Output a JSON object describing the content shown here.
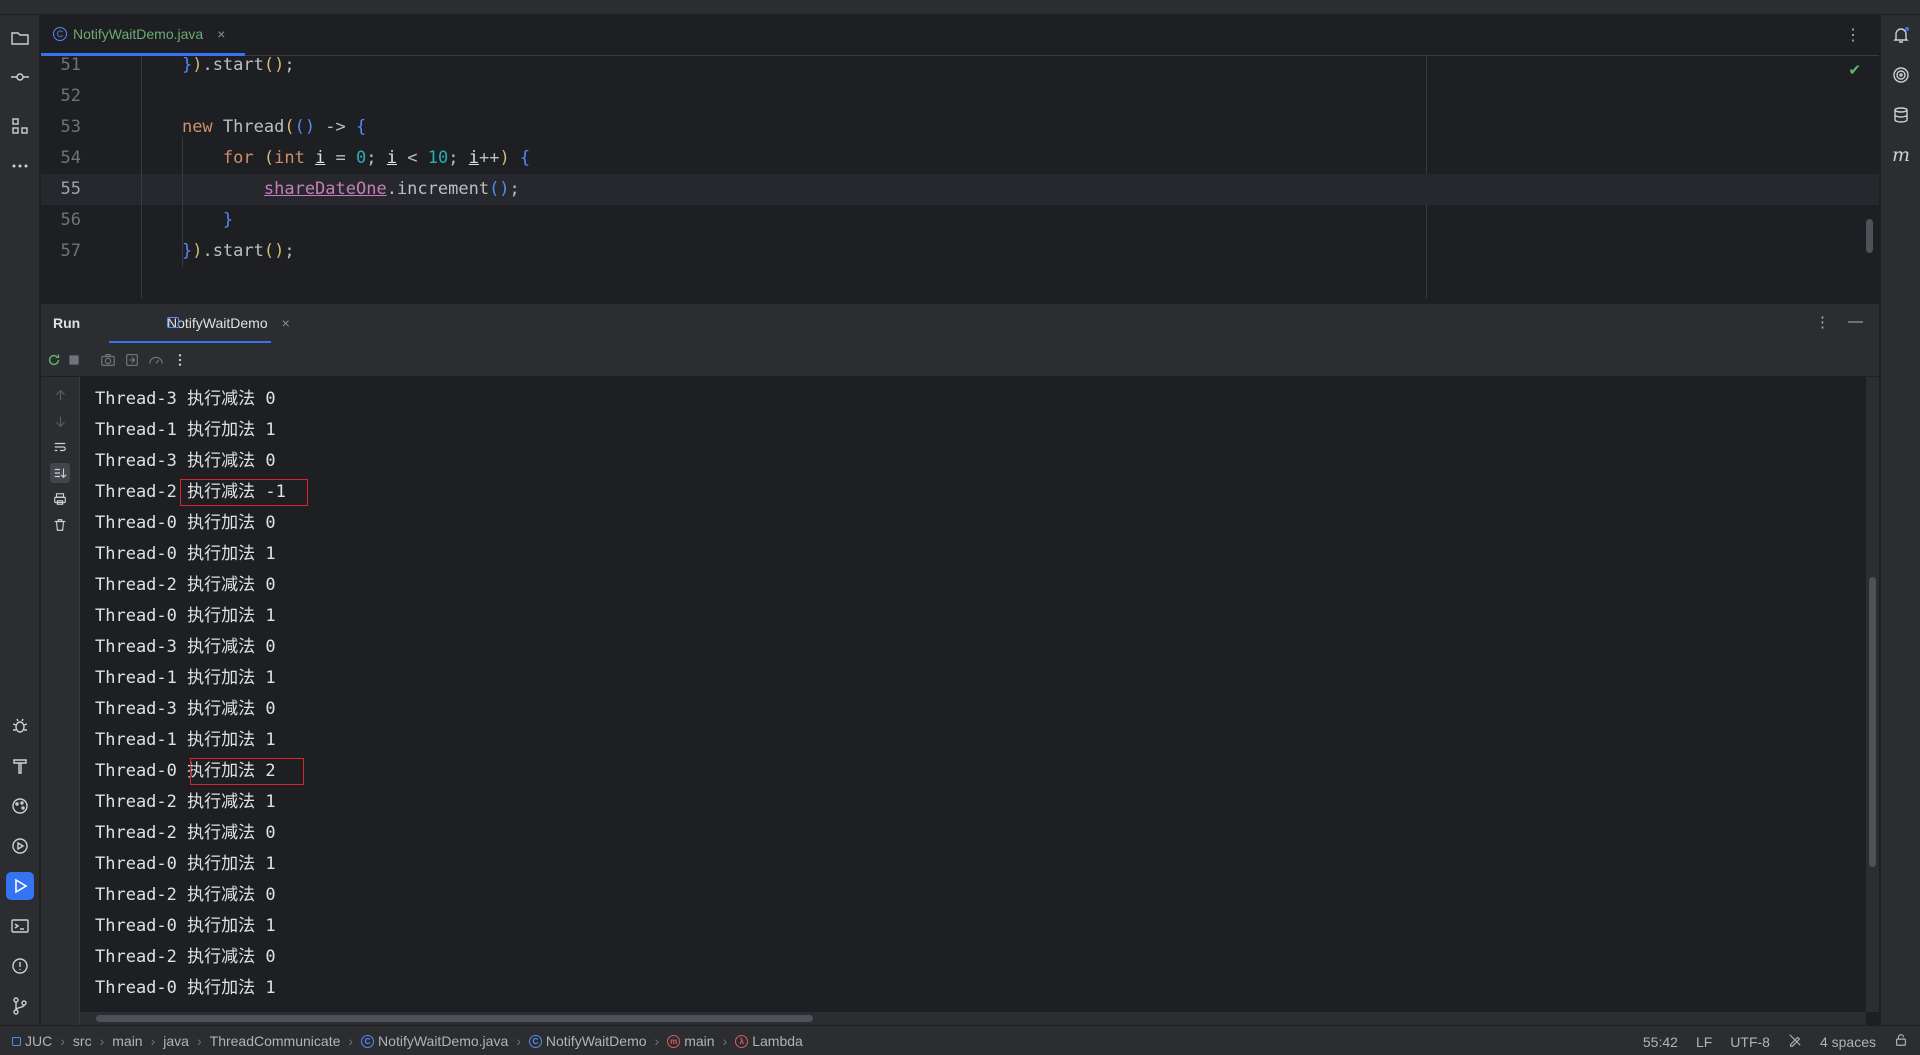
{
  "editor": {
    "tab": {
      "file_name": "NotifyWaitDemo.java",
      "close": "×"
    },
    "more": "⋮",
    "lines": [
      {
        "num": "51",
        "tokens": [
          {
            "t": "}",
            "c": "brace"
          },
          {
            "t": ")",
            "c": "paren"
          },
          {
            "t": ".start",
            "c": "fn"
          },
          {
            "t": "()",
            "c": "paren"
          },
          {
            "t": ";",
            "c": "fn"
          }
        ],
        "indent": 4
      },
      {
        "num": "52",
        "tokens": [],
        "indent": 0
      },
      {
        "num": "53",
        "tokens": [
          {
            "t": "new ",
            "c": "kw"
          },
          {
            "t": "Thread",
            "c": "fn"
          },
          {
            "t": "(",
            "c": "paren"
          },
          {
            "t": "() ",
            "c": "brace"
          },
          {
            "t": "-> ",
            "c": "fn"
          },
          {
            "t": "{",
            "c": "brace"
          }
        ],
        "indent": 4
      },
      {
        "num": "54",
        "tokens": [
          {
            "t": "for ",
            "c": "kw"
          },
          {
            "t": "(",
            "c": "paren"
          },
          {
            "t": "int ",
            "c": "kw"
          },
          {
            "t": "i",
            "c": "ul"
          },
          {
            "t": " = ",
            "c": "fn"
          },
          {
            "t": "0",
            "c": "num"
          },
          {
            "t": "; ",
            "c": "fn"
          },
          {
            "t": "i",
            "c": "ul"
          },
          {
            "t": " < ",
            "c": "fn"
          },
          {
            "t": "10",
            "c": "num"
          },
          {
            "t": "; ",
            "c": "fn"
          },
          {
            "t": "i",
            "c": "ul"
          },
          {
            "t": "++",
            "c": "fn"
          },
          {
            "t": ") ",
            "c": "paren"
          },
          {
            "t": "{",
            "c": "brace"
          }
        ],
        "indent": 8
      },
      {
        "num": "55",
        "tokens": [
          {
            "t": "shareDateOne",
            "c": "fld"
          },
          {
            "t": ".increment",
            "c": "fn"
          },
          {
            "t": "()",
            "c": "brace"
          },
          {
            "t": ";",
            "c": "fn"
          }
        ],
        "indent": 12,
        "current": true
      },
      {
        "num": "56",
        "tokens": [
          {
            "t": "}",
            "c": "brace"
          }
        ],
        "indent": 8
      },
      {
        "num": "57",
        "tokens": [
          {
            "t": "}",
            "c": "brace"
          },
          {
            "t": ")",
            "c": "paren"
          },
          {
            "t": ".start",
            "c": "fn"
          },
          {
            "t": "()",
            "c": "paren"
          },
          {
            "t": ";",
            "c": "fn"
          }
        ],
        "indent": 4
      }
    ]
  },
  "run": {
    "title": "Run",
    "tab_label": "NotifyWaitDemo",
    "close": "×",
    "more": "⋮",
    "minimize": "—",
    "output": [
      "Thread-3 执行减法 0",
      "Thread-1 执行加法 1",
      "Thread-3 执行减法 0",
      "Thread-2 执行减法 -1",
      "Thread-0 执行加法 0",
      "Thread-0 执行加法 1",
      "Thread-2 执行减法 0",
      "Thread-0 执行加法 1",
      "Thread-3 执行减法 0",
      "Thread-1 执行加法 1",
      "Thread-3 执行减法 0",
      "Thread-1 执行加法 1",
      "Thread-0 执行加法 2",
      "Thread-2 执行减法 1",
      "Thread-2 执行减法 0",
      "Thread-0 执行加法 1",
      "Thread-2 执行减法 0",
      "Thread-0 执行加法 1",
      "Thread-2 执行减法 0",
      "Thread-0 执行加法 1"
    ],
    "highlighted_lines": [
      3,
      12
    ]
  },
  "status": {
    "breadcrumbs": [
      "JUC",
      "src",
      "main",
      "java",
      "ThreadCommunicate",
      "NotifyWaitDemo.java",
      "NotifyWaitDemo",
      "main",
      "Lambda"
    ],
    "position": "55:42",
    "line_separator": "LF",
    "encoding": "UTF-8",
    "indent": "4 spaces"
  },
  "colors": {
    "accent": "#3574f0",
    "highlight_box": "#d9262a",
    "background": "#1e1f22",
    "panel": "#2b2d30"
  }
}
